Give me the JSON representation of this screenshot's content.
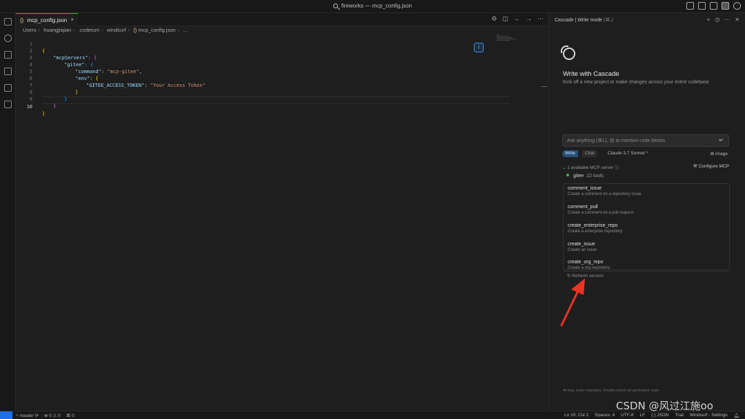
{
  "window": {
    "title": "fireworks — mcp_config.json"
  },
  "tab": {
    "label": "mcp_config.json",
    "close": "×",
    "brace": "{}"
  },
  "breadcrumb": {
    "items": [
      "Users",
      "huangjiajian",
      ".codeium",
      "windsurf",
      "mcp_config.json",
      "..."
    ]
  },
  "editor": {
    "lines": [
      {
        "n": "1"
      },
      {
        "n": "2"
      },
      {
        "n": "3"
      },
      {
        "n": "4"
      },
      {
        "n": "5"
      },
      {
        "n": "6"
      },
      {
        "n": "7"
      },
      {
        "n": "8"
      },
      {
        "n": "9"
      },
      {
        "n": "10"
      }
    ],
    "code": {
      "l1": "{",
      "l2_key": "\"mcpServers\"",
      "l2_rest": ": {",
      "l3_key": "\"gitee\"",
      "l3_rest": ": {",
      "l4_key": "\"command\"",
      "l4_val": "\"mcp-gitee\"",
      "l5_key": "\"env\"",
      "l5_rest": ": {",
      "l6_key": "\"GITEE_ACCESS_TOKEN\"",
      "l6_val": "\"Your Access Token\"",
      "l7": "}",
      "l8": "}",
      "l9": "}",
      "l10": "}"
    }
  },
  "cascade": {
    "header": "Cascade | Write mode",
    "header_hint": "(⌘.)",
    "title": "Write with Cascade",
    "subtitle": "Kick off a new project or make changes across your entire codebase",
    "input_placeholder": "Ask anything (⌘L), @ to mention code blocks",
    "enter_glyph": "↵",
    "mode_write": "Write",
    "mode_chat": "Chat",
    "model": "Claude 3.7 Sonnet ^",
    "image_btn": "Image",
    "mcp_summary": "1 available MCP server",
    "configure": "Configure MCP",
    "server_name": "gitee",
    "server_tools": "22 tools",
    "tools": [
      {
        "name": "comment_issue",
        "desc": "Create a comment on a repository issue"
      },
      {
        "name": "comment_pull",
        "desc": "Create a comment on a pull request"
      },
      {
        "name": "create_enterprise_repo",
        "desc": "Create a enterprise repository"
      },
      {
        "name": "create_issue",
        "desc": "Create an issue"
      },
      {
        "name": "create_org_repo",
        "desc": "Create a org repository"
      }
    ],
    "refresh": "Refresh servers",
    "disclaimer": "AI may make mistakes. Double-check all generated code."
  },
  "status": {
    "branch": "master",
    "problems": "⊗ 0 ⚠ 0",
    "ports": "0",
    "position": "Ln 10, Col 2",
    "spaces": "Spaces: 4",
    "encoding": "UTF-8",
    "eol": "LF",
    "language": "{ } JSON",
    "plan": "Trial",
    "settings": "Windsurf - Settings"
  },
  "watermark": "CSDN @风过江施oo",
  "colors": {
    "accent": "#3794ff",
    "arrow": "#ee3322",
    "online": "#3fb950"
  }
}
